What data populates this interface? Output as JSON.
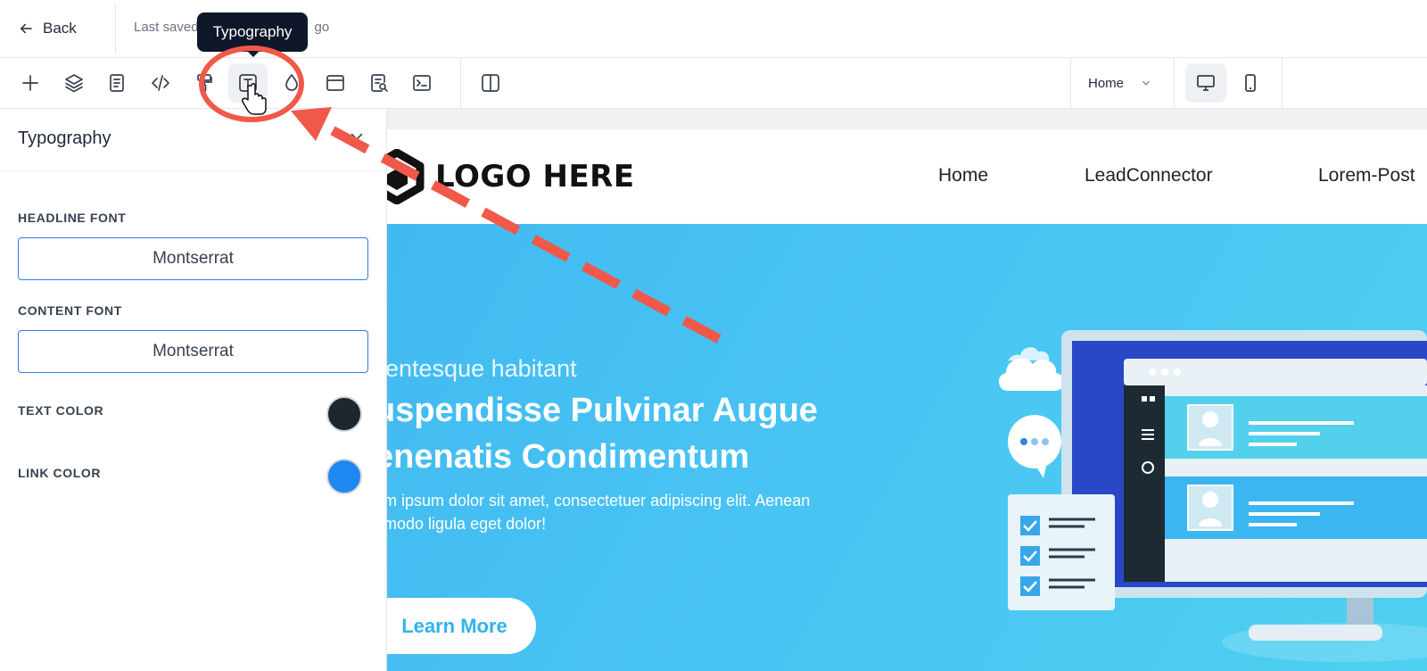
{
  "topbar": {
    "back_label": "Back",
    "saved_text": "Last saved",
    "saved_tail": "go"
  },
  "tooltip": {
    "text": "Typography"
  },
  "toolbar": {
    "icons": [
      "plus-icon",
      "layers-icon",
      "page-icon",
      "code-icon",
      "paint-roller-icon",
      "typography-icon",
      "palette-icon",
      "layout-icon",
      "seo-icon",
      "terminal-icon",
      "split-view-icon"
    ],
    "page_select": "Home",
    "devices": [
      "desktop-icon",
      "mobile-icon"
    ]
  },
  "panel": {
    "title": "Typography",
    "headline_font_label": "HEADLINE FONT",
    "headline_font_value": "Montserrat",
    "content_font_label": "CONTENT FONT",
    "content_font_value": "Montserrat",
    "text_color_label": "TEXT COLOR",
    "text_color": "#1f272e",
    "link_color_label": "LINK COLOR",
    "link_color": "#1e88f0"
  },
  "site": {
    "logo_text": "LOGO HERE",
    "nav": [
      "Home",
      "LeadConnector",
      "Lorem-Post"
    ],
    "hero_kicker": "llentesque habitant",
    "hero_title_line1": "uspendisse Pulvinar Augue",
    "hero_title_line2": "enenatis Condimentum",
    "hero_text_line1": "em ipsum dolor sit amet, consectetuer adipiscing elit. Aenean",
    "hero_text_line2": "nmodo ligula eget dolor!",
    "cta": "Learn More"
  },
  "colors": {
    "accent": "#2b7de9",
    "annotation": "#f0594a",
    "hero": "#47c2f3"
  }
}
